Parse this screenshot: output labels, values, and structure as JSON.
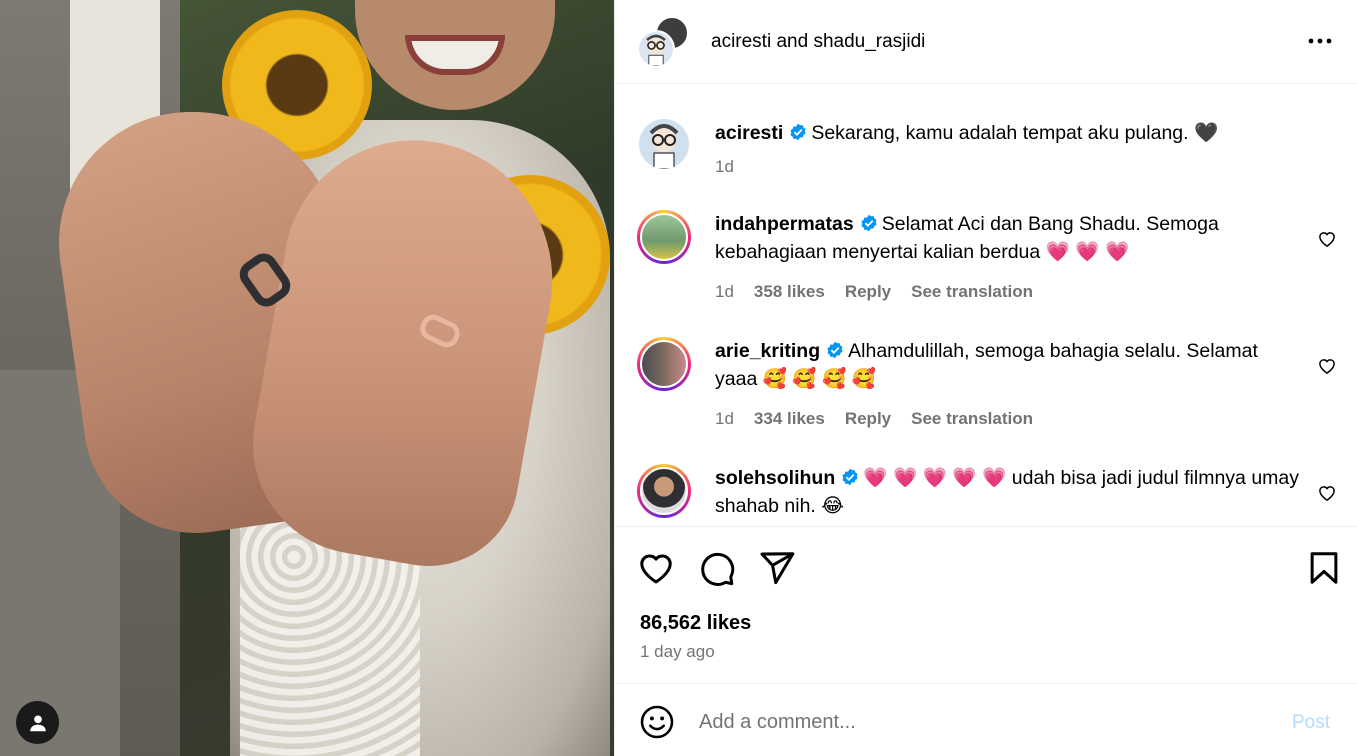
{
  "header": {
    "names": "aciresti and shadu_rasjidi"
  },
  "caption": {
    "username": "aciresti",
    "text": "Sekarang, kamu adalah tempat aku pulang. 🖤",
    "time": "1d"
  },
  "comments": [
    {
      "username": "indahpermatas",
      "text": "Selamat Aci dan Bang Shadu. Semoga kebahagiaan menyertai kalian berdua 💗 💗 💗",
      "time": "1d",
      "likes": "358 likes",
      "reply": "Reply",
      "translate": "See translation"
    },
    {
      "username": "arie_kriting",
      "text": "Alhamdulillah, semoga bahagia selalu. Selamat yaaa 🥰 🥰 🥰 🥰",
      "time": "1d",
      "likes": "334 likes",
      "reply": "Reply",
      "translate": "See translation"
    },
    {
      "username": "solehsolihun",
      "text": "💗 💗 💗 💗 💗 udah bisa jadi judul filmnya umay shahab nih. 😂"
    }
  ],
  "post": {
    "likes": "86,562 likes",
    "timestamp": "1 day ago"
  },
  "add_comment": {
    "placeholder": "Add a comment...",
    "post_label": "Post"
  },
  "colors": {
    "verified": "#0095f6",
    "secondary_text": "#737373",
    "post_button_disabled": "#b3dbff"
  }
}
